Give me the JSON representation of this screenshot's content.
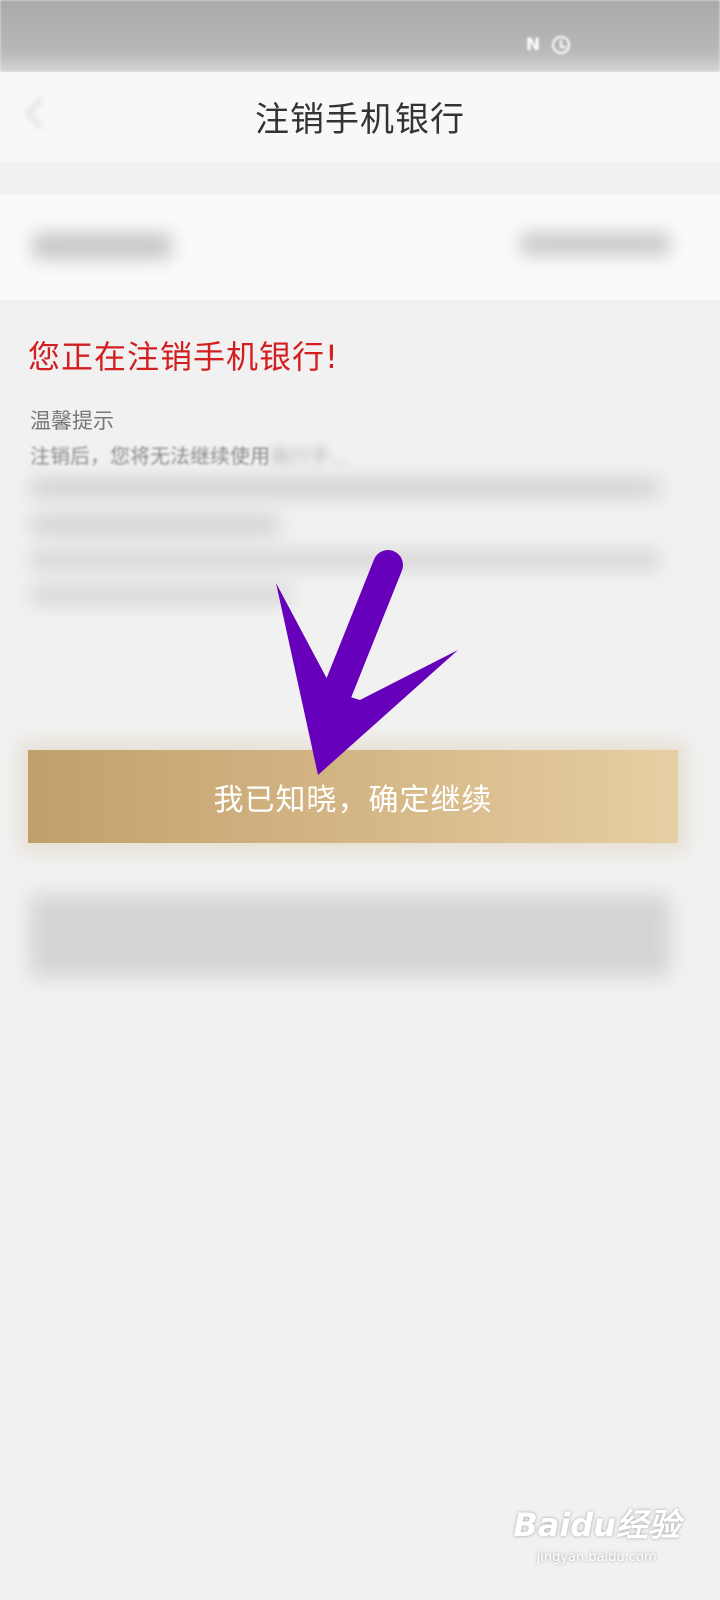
{
  "status_bar": {
    "icons": [
      "nfc-icon",
      "alarm-icon"
    ],
    "nfc_glyph": "N"
  },
  "header": {
    "title": "注销手机银行"
  },
  "warning": {
    "title": "您正在注销手机银行!"
  },
  "tips": {
    "label": "温馨提示",
    "line1": "注销后，您将无法继续使用",
    "line1_faded": "我行手..."
  },
  "buttons": {
    "confirm_label": "我已知晓，确定继续"
  },
  "annotation": {
    "arrow_color": "#6600bb"
  },
  "colors": {
    "warning_red": "#d31f1f",
    "button_gold_start": "#c2a06c",
    "button_gold_end": "#e6cfa4"
  },
  "watermark": {
    "logo": "Baidu经验",
    "sub": "jingyan.baidu.com"
  }
}
